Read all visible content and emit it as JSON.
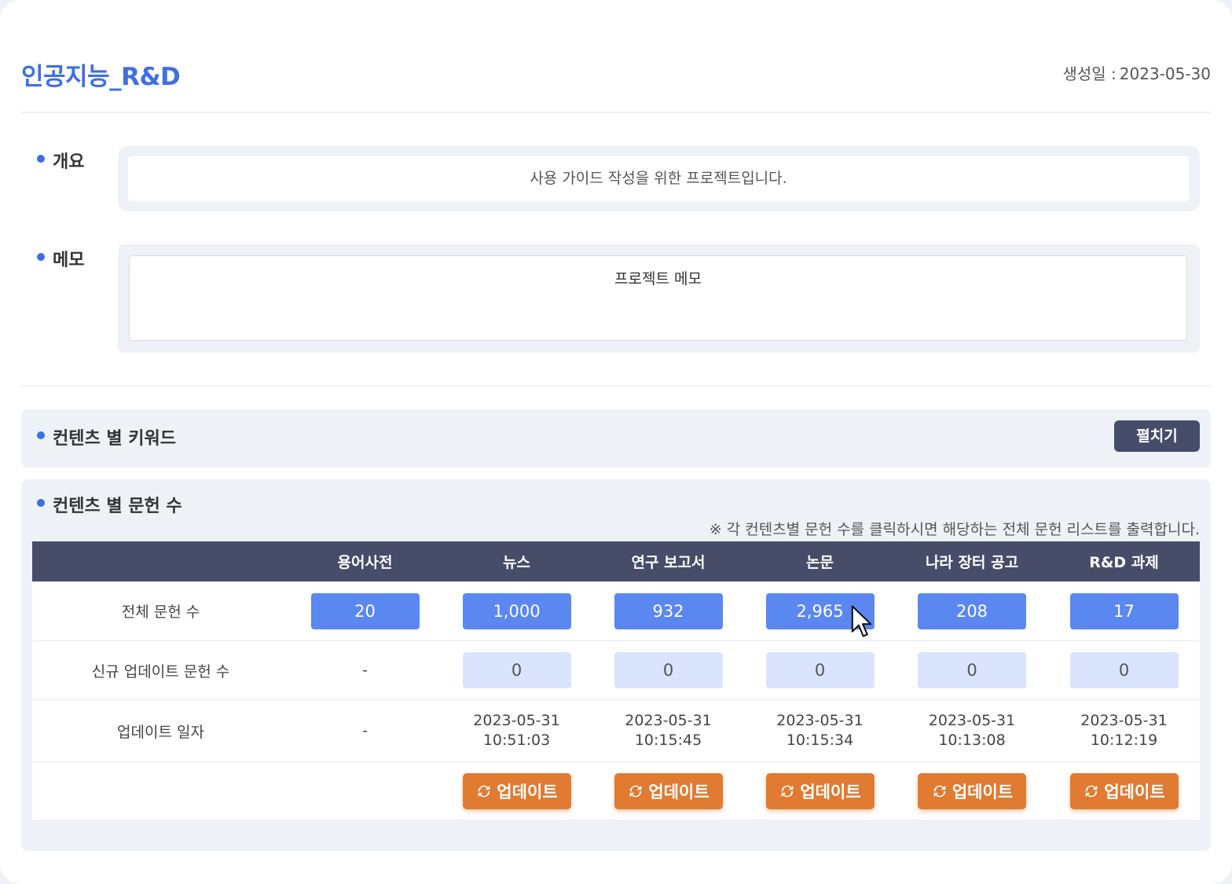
{
  "header": {
    "title": "인공지능_R&D",
    "created_label": "생성일 :",
    "created_value": "2023-05-30"
  },
  "summary": {
    "label": "개요",
    "text": "사용 가이드 작성을 위한 프로젝트입니다."
  },
  "memo": {
    "label": "메모",
    "text": "프로젝트 메모"
  },
  "keywords_section": {
    "label": "컨텐츠 별 키워드",
    "expand_label": "펼치기"
  },
  "counts_section": {
    "label": "컨텐츠 별 문헌 수",
    "note": "※ 각 컨텐츠별 문헌 수를 클릭하시면 해당하는 전체 문헌 리스트를 출력합니다.",
    "columns": [
      "",
      "용어사전",
      "뉴스",
      "연구 보고서",
      "논문",
      "나라 장터 공고",
      "R&D 과제"
    ],
    "row_labels": {
      "total": "전체 문헌 수",
      "new": "신규 업데이트 문헌 수",
      "updated": "업데이트 일자"
    },
    "total": [
      "20",
      "1,000",
      "932",
      "2,965",
      "208",
      "17"
    ],
    "new": [
      "-",
      "0",
      "0",
      "0",
      "0",
      "0"
    ],
    "updated": [
      {
        "date": "-",
        "time": ""
      },
      {
        "date": "2023-05-31",
        "time": "10:51:03"
      },
      {
        "date": "2023-05-31",
        "time": "10:15:45"
      },
      {
        "date": "2023-05-31",
        "time": "10:15:34"
      },
      {
        "date": "2023-05-31",
        "time": "10:13:08"
      },
      {
        "date": "2023-05-31",
        "time": "10:12:19"
      }
    ],
    "update_button_label": "업데이트"
  },
  "colors": {
    "accent": "#3f6fe4",
    "header_bg": "#474c69",
    "count_btn": "#5b87f0",
    "new_btn": "#dbe4fd",
    "update_btn": "#e07b31"
  }
}
